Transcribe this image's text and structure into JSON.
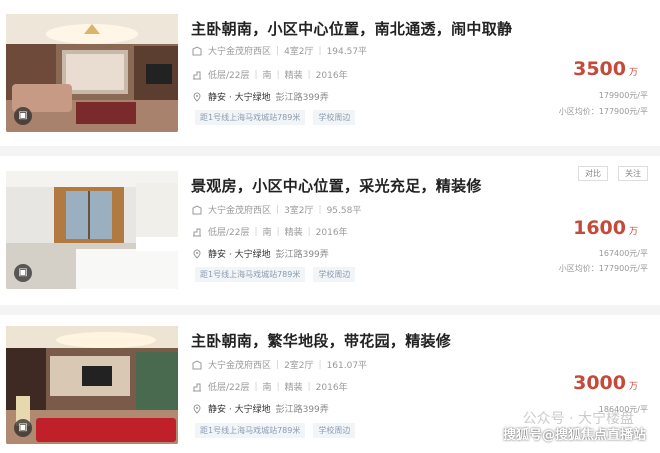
{
  "listings": [
    {
      "title": "主卧朝南，小区中心位置，南北通透，闹中取静",
      "community": "大宁金茂府西区",
      "layout": "4室2厅",
      "area": "194.57平",
      "floor": "低层/22层",
      "orientation": "南",
      "decoration": "精装",
      "year": "2016年",
      "district": "静安 · 大宁绿地",
      "address": "彭江路399弄",
      "tags": [
        "距1号线上海马戏城站789米",
        "学校周边"
      ],
      "price": "3500",
      "price_unit": "万",
      "unit_price": "179900元/平",
      "avg_price": "小区均价：177900元/平"
    },
    {
      "title": "景观房，小区中心位置，采光充足，精装修",
      "community": "大宁金茂府西区",
      "layout": "3室2厅",
      "area": "95.58平",
      "floor": "低层/22层",
      "orientation": "南",
      "decoration": "精装",
      "year": "2016年",
      "district": "静安 · 大宁绿地",
      "address": "彭江路399弄",
      "tags": [
        "距1号线上海马戏城站789米",
        "学校周边"
      ],
      "price": "1600",
      "price_unit": "万",
      "unit_price": "167400元/平",
      "avg_price": "小区均价：177900元/平",
      "compare_label": "对比",
      "follow_label": "关注"
    },
    {
      "title": "主卧朝南，繁华地段，带花园，精装修",
      "community": "大宁金茂府西区",
      "layout": "2室2厅",
      "area": "161.07平",
      "floor": "低层/22层",
      "orientation": "南",
      "decoration": "精装",
      "year": "2016年",
      "district": "静安 · 大宁绿地",
      "address": "彭江路399弄",
      "tags": [
        "距1号线上海马戏城站789米",
        "学校周边"
      ],
      "price": "3000",
      "price_unit": "万",
      "unit_price": "186400元/平"
    }
  ],
  "watermark": "搜狐号@搜狐焦点直播站",
  "watermark_faint": "公众号 · 大宁楼盘",
  "colors": {
    "price": "#c54a3a",
    "tag_text": "#8a9bb0",
    "tag_bg": "#f2f5f8"
  }
}
